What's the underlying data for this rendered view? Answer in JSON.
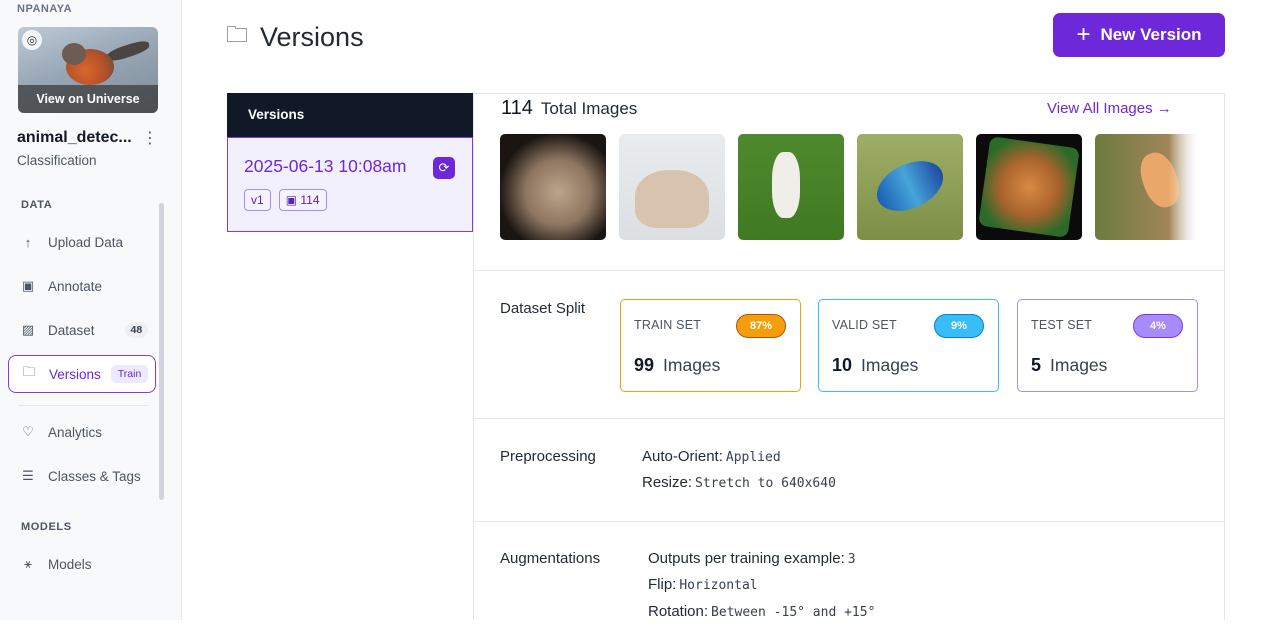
{
  "workspace": "NPANAYA",
  "thumbnail": {
    "view_label": "View on Universe"
  },
  "project": {
    "name": "animal_detec...",
    "type": "Classification"
  },
  "sections": {
    "data": "DATA",
    "models": "MODELS"
  },
  "nav": [
    {
      "label": "Upload Data",
      "icon": "upload-icon"
    },
    {
      "label": "Annotate",
      "icon": "annotate-icon"
    },
    {
      "label": "Dataset",
      "icon": "dataset-icon",
      "badge": "48"
    },
    {
      "label": "Versions",
      "icon": "versions-icon",
      "badge": "Train",
      "active": true
    },
    {
      "label": "Analytics",
      "icon": "heart-pulse-icon"
    },
    {
      "label": "Classes & Tags",
      "icon": "list-icon"
    },
    {
      "label": "Models",
      "icon": "models-icon"
    }
  ],
  "page": {
    "title": "Versions",
    "new_version_label": "New Version"
  },
  "versions_panel": {
    "header": "Versions",
    "items": [
      {
        "date": "2025-06-13 10:08am",
        "tag": "v1",
        "images": "114"
      }
    ]
  },
  "main": {
    "total_num": "114",
    "total_label": "Total Images",
    "view_all": "View All Images →",
    "split_label": "Dataset Split",
    "splits": [
      {
        "name": "TRAIN SET",
        "pct": "87%",
        "count": "99",
        "unit": "Images",
        "color": "#f59e0b"
      },
      {
        "name": "VALID SET",
        "pct": "9%",
        "count": "10",
        "unit": "Images",
        "color": "#38bdf8"
      },
      {
        "name": "TEST SET",
        "pct": "4%",
        "count": "5",
        "unit": "Images",
        "color": "#a78bfa"
      }
    ],
    "preprocessing_label": "Preprocessing",
    "preprocessing": [
      {
        "key": "Auto-Orient:",
        "value": "Applied"
      },
      {
        "key": "Resize:",
        "value": "Stretch to 640x640"
      }
    ],
    "augmentations_label": "Augmentations",
    "augmentations": [
      {
        "key": "Outputs per training example:",
        "value": "3"
      },
      {
        "key": "Flip:",
        "value": "Horizontal"
      },
      {
        "key": "Rotation:",
        "value": "Between -15° and +15°"
      }
    ]
  }
}
